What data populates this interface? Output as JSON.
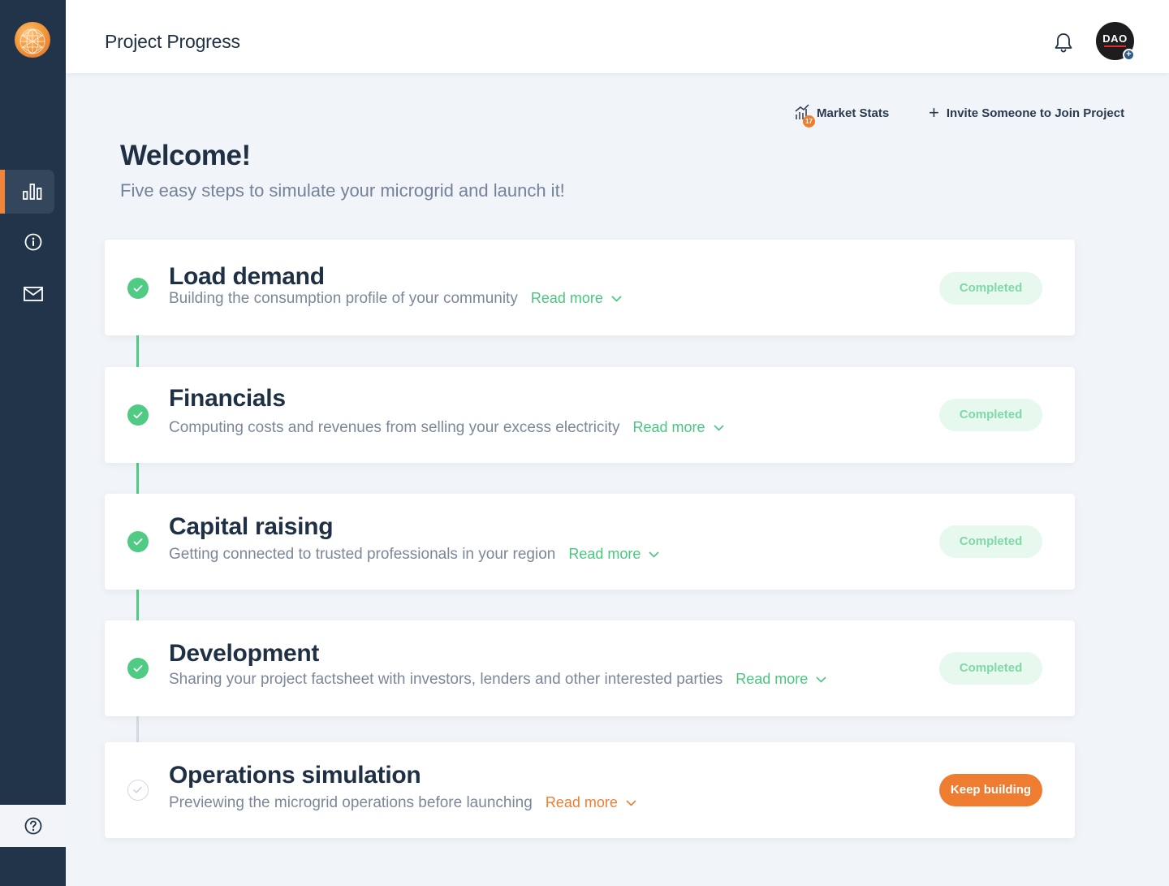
{
  "header": {
    "title": "Project Progress",
    "avatar_text": "DAO",
    "avatar_badge": "+"
  },
  "sidebar": {
    "items": [
      {
        "name": "bar-chart-icon",
        "active": true
      },
      {
        "name": "info-icon",
        "active": false
      },
      {
        "name": "mail-icon",
        "active": false
      }
    ],
    "help_icon": "help-circle-icon"
  },
  "actions": {
    "market_stats_label": "Market Stats",
    "market_stats_badge": "17",
    "invite_label": "Invite Someone to Join Project",
    "invite_icon": "+"
  },
  "welcome": {
    "title": "Welcome!",
    "subtitle": "Five easy steps to simulate your microgrid and launch it!"
  },
  "steps": [
    {
      "title": "Load demand",
      "description": "Building the consumption profile of your community",
      "read_more": "Read more",
      "status": "Completed",
      "done": true
    },
    {
      "title": "Financials",
      "description": "Computing costs and revenues from selling your excess electricity",
      "read_more": "Read more",
      "status": "Completed",
      "done": true
    },
    {
      "title": "Capital raising",
      "description": "Getting connected to trusted professionals in your region",
      "read_more": "Read more",
      "status": "Completed",
      "done": true
    },
    {
      "title": "Development",
      "description": "Sharing your project factsheet with investors, lenders and other interested parties",
      "read_more": "Read more",
      "status": "Completed",
      "done": true
    },
    {
      "title": "Operations simulation",
      "description": "Previewing the microgrid operations before launching",
      "read_more": "Read more",
      "status": "Keep building",
      "done": false
    }
  ],
  "colors": {
    "sidebar": "#22344a",
    "accent_orange": "#ef7d31",
    "success_green": "#4fcb83",
    "background": "#f1f4f8"
  }
}
